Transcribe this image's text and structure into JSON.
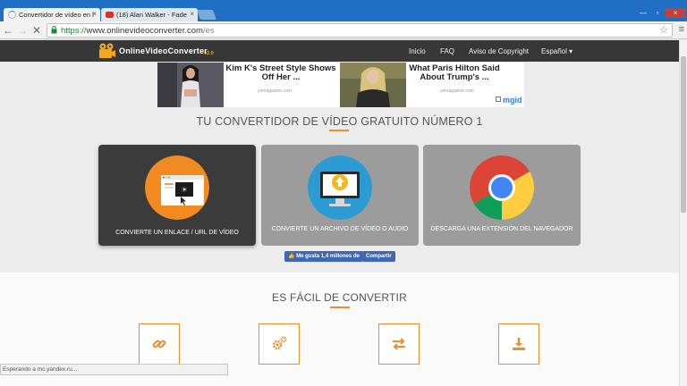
{
  "browser": {
    "tabs": [
      {
        "title": "Convertidor de vídeo en l",
        "active": true
      },
      {
        "title": "(18) Alan Walker - Fade",
        "active": false
      }
    ],
    "url_scheme": "https://",
    "url_host": "www.onlinevideoconverter.com",
    "url_path": "/es",
    "status": "Esperando a mc.yandex.ru..."
  },
  "site": {
    "logo_text": "OnlineVideoConverter",
    "logo_version": "v2.0",
    "nav": [
      "Inicio",
      "FAQ",
      "Aviso de Copyright",
      "Español ▾"
    ]
  },
  "ads": [
    {
      "title": "Kim K's Street Style Shows Off Her ...",
      "source": "yomagazine.com"
    },
    {
      "title": "What Paris Hilton Said About Trump's ...",
      "source": "yomagazine.com"
    }
  ],
  "ads_brand": "mgid",
  "hero": {
    "title": "TU CONVERTIDOR DE VÍDEO GRATUITO NÚMERO 1",
    "cards": [
      {
        "caption": "CONVIERTE UN ENLACE / URL DE VÍDEO",
        "icon": "screen-link-icon"
      },
      {
        "caption": "CONVIERTE UN ARCHIVO DE VÍDEO O AUDIO",
        "icon": "upload-monitor-icon"
      },
      {
        "caption": "DESCARGA UNA EXTENSIÓN DEL NAVEGADOR",
        "icon": "chrome-icon"
      }
    ]
  },
  "social": {
    "like_label": "Me gusta 1,4 millones de",
    "share_label": "Compartir"
  },
  "steps": {
    "title": "ES FÁCIL DE CONVERTIR",
    "icons": [
      "link-icon",
      "gears-icon",
      "arrows-icon",
      "download-icon"
    ]
  },
  "colors": {
    "accent": "#f08c2c",
    "nav_bg": "#373737",
    "fb_blue": "#4267b2"
  }
}
